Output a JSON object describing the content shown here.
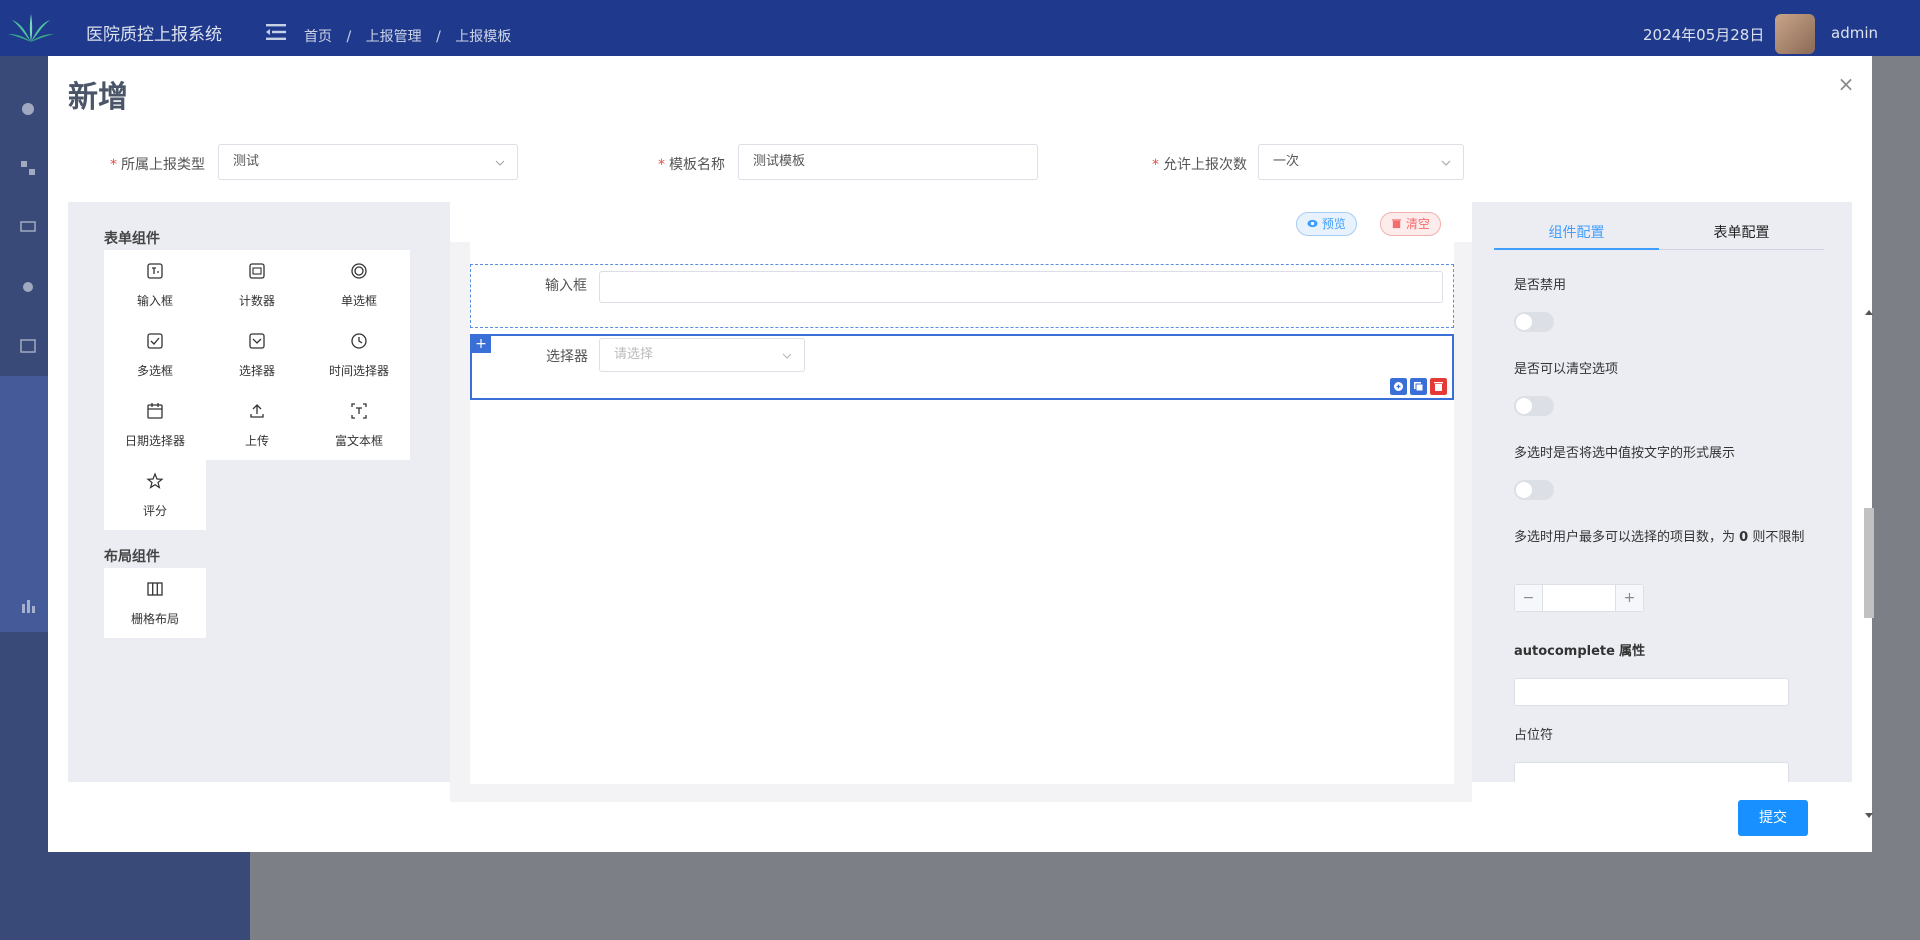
{
  "app": {
    "system_title": "医院质控上报系统",
    "breadcrumb": [
      "首页",
      "/",
      "上报管理",
      "/",
      "上报模板"
    ],
    "date": "2024年05月28日",
    "user": "admin"
  },
  "modal": {
    "title": "新增",
    "close_label": "×",
    "fields": {
      "type": {
        "label": "所属上报类型",
        "value": "测试"
      },
      "name": {
        "label": "模板名称",
        "value": "测试模板"
      },
      "times": {
        "label": "允许上报次数",
        "value": "一次"
      }
    },
    "submit_label": "提交"
  },
  "palette": {
    "form_title": "表单组件",
    "form_items": [
      "输入框",
      "计数器",
      "单选框",
      "多选框",
      "选择器",
      "时间选择器",
      "日期选择器",
      "上传",
      "富文本框",
      "评分"
    ],
    "layout_title": "布局组件",
    "layout_items": [
      "栅格布局"
    ]
  },
  "canvas": {
    "preview_label": "预览",
    "clear_label": "清空",
    "input_field_label": "输入框",
    "select_field_label": "选择器",
    "select_placeholder": "请选择",
    "drag_icon": "+"
  },
  "config": {
    "tab_component": "组件配置",
    "tab_form": "表单配置",
    "disabled_label": "是否禁用",
    "clearable_label": "是否可以清空选项",
    "collapse_tags_label": "多选时是否将选中值按文字的形式展示",
    "multiple_limit_label_1": "多选时用户最多可以选择的项目数，为",
    "multiple_limit_bold": "0",
    "multiple_limit_label_2": "则不限制",
    "stepper_minus": "−",
    "stepper_plus": "+",
    "autocomplete_bold": "autocomplete",
    "autocomplete_rest": "属性",
    "placeholder_label": "占位符"
  }
}
